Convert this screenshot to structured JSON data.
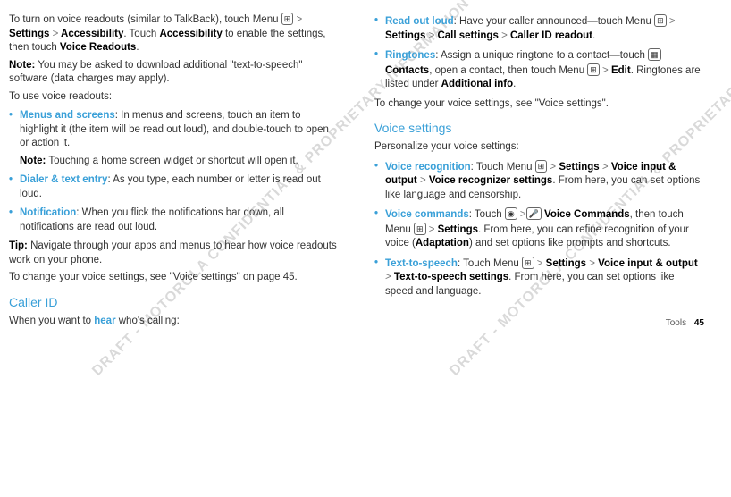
{
  "col1": {
    "p1a": "To turn on voice readouts (similar to TalkBack), touch Menu ",
    "p1b": " Settings ",
    "p1c": " Accessibility",
    "p1d": ". Touch ",
    "p1e": "Accessibility",
    "p1f": " to enable the settings, then touch ",
    "p1g": "Voice Readouts",
    "p1h": ".",
    "noteLbl": "Note:",
    "note1": " You may be asked to download additional \"text-to-speech\" software (data charges may apply).",
    "p2": "To use voice readouts:",
    "b1t": "Menus and screens",
    "b1": ": In menus and screens, touch an item to highlight it (the item will be read out loud), and double-touch to open or action it.",
    "b1note": " Touching a home screen widget or shortcut will open it.",
    "b2t": "Dialer & text entry",
    "b2": ": As you type, each number or letter is read out loud.",
    "b3t": "Notification",
    "b3": ": When you flick the notifications bar down, all notifications are read out loud.",
    "tipLbl": "Tip:",
    "tip": " Navigate through your apps and menus to hear how voice readouts work on your phone.",
    "p3": "To change your voice settings, see \"Voice settings\" on page 45.",
    "h1": "Caller ID",
    "p4a": "When you want to ",
    "p4b": "hear",
    "p4c": " who's calling:"
  },
  "col2": {
    "r1t": "Read out loud",
    "r1a": ": Have your caller announced—touch Menu ",
    "r1b": " Settings ",
    "r1c": " Call settings ",
    "r1d": " Caller ID readout",
    "r1e": ".",
    "r2t": "Ringtones",
    "r2a": ": Assign a unique ringtone to a contact—touch ",
    "r2b": " Contacts",
    "r2c": ", open a contact, then touch Menu ",
    "r2d": " Edit",
    "r2e": ". Ringtones are listed under ",
    "r2f": "Additional info",
    "r2g": ".",
    "p5": "To change your voice settings, see \"Voice settings\".",
    "h2": "Voice settings",
    "p6": "Personalize your voice settings:",
    "v1t": "Voice recognition",
    "v1a": ": Touch Menu ",
    "v1b": " Settings ",
    "v1c": " Voice input & output ",
    "v1d": " Voice recognizer settings",
    "v1e": ". From here, you can set options like language and censorship.",
    "v2t": "Voice commands",
    "v2a": ": Touch ",
    "v2b": " Voice Commands",
    "v2c": ", then touch Menu ",
    "v2d": " Settings",
    "v2e": ". From here, you can refine recognition of your voice (",
    "v2f": "Adaptation",
    "v2g": ") and set options like prompts and shortcuts.",
    "v3t": "Text-to-speech",
    "v3a": ": Touch Menu ",
    "v3b": " Settings ",
    "v3c": " Voice input & output ",
    "v3d": " Text-to-speech settings",
    "v3e": ". From here, you can set options like speed and language.",
    "footer": "Tools",
    "page": "45"
  },
  "gt": ">",
  "menuIcon": "⊞",
  "wm": "DRAFT - MOTOROLA CONFIDENTIAL\n& PROPRIETARY INFORMATION"
}
